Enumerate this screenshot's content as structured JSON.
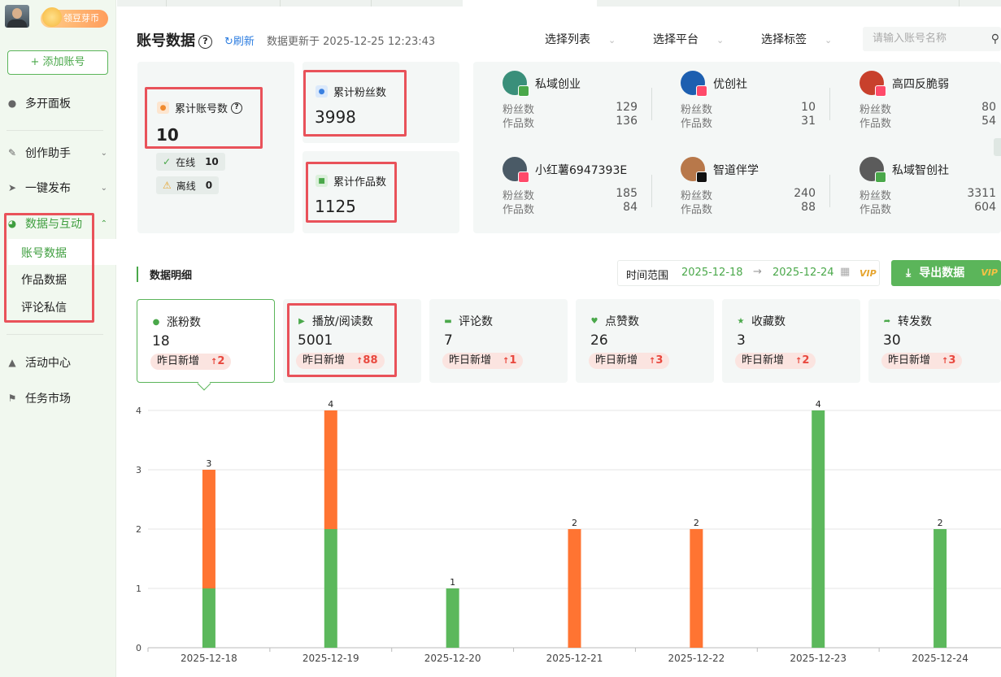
{
  "sidebar": {
    "coin_label": "领豆芽币",
    "add_account": "+ 添加账号",
    "items": [
      {
        "label": "多开面板",
        "icon": "user-icon"
      },
      {
        "label": "创作助手",
        "icon": "pen-icon"
      },
      {
        "label": "一键发布",
        "icon": "send-icon"
      },
      {
        "label": "数据与互动",
        "icon": "pie-chart-icon"
      },
      {
        "label": "活动中心",
        "icon": "megaphone-icon"
      },
      {
        "label": "任务市场",
        "icon": "flag-icon"
      }
    ],
    "sub_items": [
      "账号数据",
      "作品数据",
      "评论私信"
    ]
  },
  "header": {
    "title": "账号数据",
    "help": "?",
    "refresh": "刷新",
    "updated": "数据更新于 2025-12-25 12:23:43",
    "select_list": "选择列表",
    "select_platform": "选择平台",
    "select_tag": "选择标签",
    "search_placeholder": "请输入账号名称"
  },
  "stats": {
    "accounts_label": "累计账号数",
    "accounts_value": "10",
    "online_label": "在线",
    "online_value": "10",
    "offline_label": "离线",
    "offline_value": "0",
    "fans_label": "累计粉丝数",
    "fans_value": "3998",
    "works_label": "累计作品数",
    "works_value": "1125"
  },
  "accounts": [
    {
      "name": "私域创业",
      "fans_label": "粉丝数",
      "fans": "129",
      "works_label": "作品数",
      "works": "136",
      "color": "#3a8f7a"
    },
    {
      "name": "优创社",
      "fans_label": "粉丝数",
      "fans": "10",
      "works_label": "作品数",
      "works": "31",
      "color": "#1d5fb0"
    },
    {
      "name": "高四反脆弱",
      "fans_label": "粉丝数",
      "fans": "80",
      "works_label": "作品数",
      "works": "54",
      "color": "#c8402c"
    },
    {
      "name": "小红薯6947393E",
      "fans_label": "粉丝数",
      "fans": "185",
      "works_label": "作品数",
      "works": "84",
      "color": "#4a5a66"
    },
    {
      "name": "智道伴学",
      "fans_label": "粉丝数",
      "fans": "240",
      "works_label": "作品数",
      "works": "88",
      "color": "#b8784a"
    },
    {
      "name": "私域智创社",
      "fans_label": "粉丝数",
      "fans": "3311",
      "works_label": "作品数",
      "works": "604",
      "color": "#5b5b5b"
    }
  ],
  "detail": {
    "title": "数据明细",
    "range_label": "时间范围",
    "start": "2025-12-18",
    "end": "2025-12-24",
    "vip": "VIP",
    "export": "导出数据"
  },
  "metrics": [
    {
      "label": "涨粉数",
      "value": "18",
      "yd_label": "昨日新增",
      "yd": "2",
      "icon": "user-plus-icon",
      "color": "#4aa84a"
    },
    {
      "label": "播放/阅读数",
      "value": "5001",
      "yd_label": "昨日新增",
      "yd": "88",
      "icon": "play-icon",
      "color": "#4aa84a"
    },
    {
      "label": "评论数",
      "value": "7",
      "yd_label": "昨日新增",
      "yd": "1",
      "icon": "comment-icon",
      "color": "#4aa84a"
    },
    {
      "label": "点赞数",
      "value": "26",
      "yd_label": "昨日新增",
      "yd": "3",
      "icon": "heart-icon",
      "color": "#4aa84a"
    },
    {
      "label": "收藏数",
      "value": "3",
      "yd_label": "昨日新增",
      "yd": "2",
      "icon": "star-icon",
      "color": "#4aa84a"
    },
    {
      "label": "转发数",
      "value": "30",
      "yd_label": "昨日新增",
      "yd": "3",
      "icon": "share-icon",
      "color": "#4aa84a"
    }
  ],
  "chart_data": {
    "type": "bar",
    "stacked": true,
    "categories": [
      "2025-12-18",
      "2025-12-19",
      "2025-12-20",
      "2025-12-21",
      "2025-12-22",
      "2025-12-23",
      "2025-12-24"
    ],
    "series": [
      {
        "values": [
          1,
          2,
          1,
          0,
          0,
          4,
          2
        ],
        "color": "#5cb85c"
      },
      {
        "values": [
          2,
          2,
          0,
          2,
          2,
          0,
          0
        ],
        "color": "#ff7432"
      }
    ],
    "totals": [
      3,
      4,
      1,
      2,
      2,
      4,
      2
    ],
    "ylim": [
      0,
      4
    ],
    "yticks": [
      0,
      1,
      2,
      3,
      4
    ],
    "grid": true
  }
}
